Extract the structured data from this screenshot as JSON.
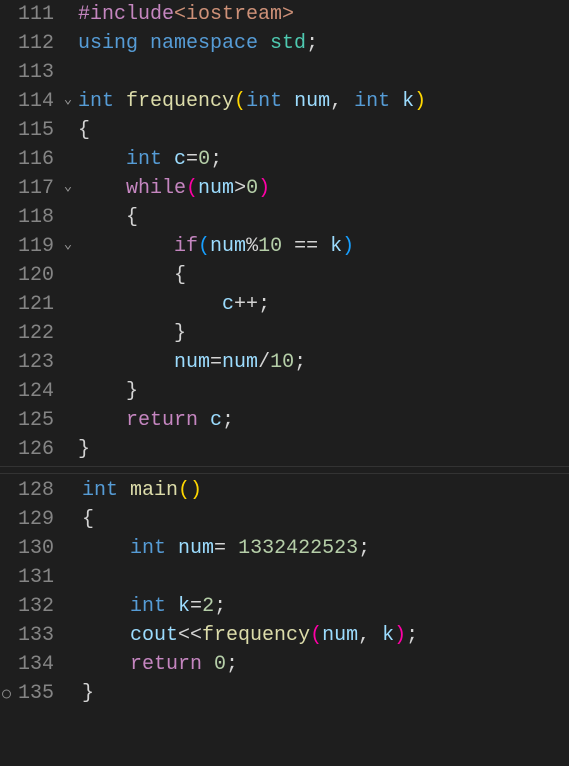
{
  "lines": [
    {
      "n": "111",
      "fold": "",
      "tokens": [
        [
          "pp",
          "#include"
        ],
        [
          "str",
          "<iostream>"
        ]
      ]
    },
    {
      "n": "112",
      "fold": "",
      "tokens": [
        [
          "kw",
          "using "
        ],
        [
          "kw",
          "namespace "
        ],
        [
          "ns",
          "std"
        ],
        [
          "punc",
          ";"
        ]
      ]
    },
    {
      "n": "113",
      "fold": "",
      "tokens": []
    },
    {
      "n": "114",
      "fold": "v",
      "tokens": [
        [
          "kw",
          "int "
        ],
        [
          "fn",
          "frequency"
        ],
        [
          "parenY",
          "("
        ],
        [
          "kw",
          "int "
        ],
        [
          "var",
          "num"
        ],
        [
          "punc",
          ", "
        ],
        [
          "kw",
          "int "
        ],
        [
          "var",
          "k"
        ],
        [
          "parenY",
          ")"
        ]
      ]
    },
    {
      "n": "115",
      "fold": "",
      "tokens": [
        [
          "punc",
          "{"
        ]
      ]
    },
    {
      "n": "116",
      "fold": "",
      "tokens": [
        [
          "punc",
          "    "
        ],
        [
          "kw",
          "int "
        ],
        [
          "var",
          "c"
        ],
        [
          "op",
          "="
        ],
        [
          "num",
          "0"
        ],
        [
          "punc",
          ";"
        ]
      ]
    },
    {
      "n": "117",
      "fold": "v",
      "tokens": [
        [
          "punc",
          "    "
        ],
        [
          "kw2",
          "while"
        ],
        [
          "paren",
          "("
        ],
        [
          "var",
          "num"
        ],
        [
          "op",
          ">"
        ],
        [
          "num",
          "0"
        ],
        [
          "paren",
          ")"
        ]
      ]
    },
    {
      "n": "118",
      "fold": "",
      "tokens": [
        [
          "punc",
          "    {"
        ]
      ]
    },
    {
      "n": "119",
      "fold": "v",
      "tokens": [
        [
          "punc",
          "        "
        ],
        [
          "kw2",
          "if"
        ],
        [
          "paren2",
          "("
        ],
        [
          "var",
          "num"
        ],
        [
          "op",
          "%"
        ],
        [
          "num",
          "10"
        ],
        [
          "op",
          " == "
        ],
        [
          "var",
          "k"
        ],
        [
          "paren2",
          ")"
        ]
      ]
    },
    {
      "n": "120",
      "fold": "",
      "tokens": [
        [
          "punc",
          "        {"
        ]
      ]
    },
    {
      "n": "121",
      "fold": "",
      "tokens": [
        [
          "punc",
          "            "
        ],
        [
          "var",
          "c"
        ],
        [
          "op",
          "++"
        ],
        [
          "punc",
          ";"
        ]
      ]
    },
    {
      "n": "122",
      "fold": "",
      "tokens": [
        [
          "punc",
          "        }"
        ]
      ]
    },
    {
      "n": "123",
      "fold": "",
      "tokens": [
        [
          "punc",
          "        "
        ],
        [
          "var",
          "num"
        ],
        [
          "op",
          "="
        ],
        [
          "var",
          "num"
        ],
        [
          "op",
          "/"
        ],
        [
          "num",
          "10"
        ],
        [
          "punc",
          ";"
        ]
      ]
    },
    {
      "n": "124",
      "fold": "",
      "tokens": [
        [
          "punc",
          "    }"
        ]
      ]
    },
    {
      "n": "125",
      "fold": "",
      "tokens": [
        [
          "punc",
          "    "
        ],
        [
          "kw2",
          "return "
        ],
        [
          "var",
          "c"
        ],
        [
          "punc",
          ";"
        ]
      ]
    },
    {
      "n": "126",
      "fold": "",
      "tokens": [
        [
          "punc",
          "}"
        ]
      ]
    }
  ],
  "lines2": [
    {
      "n": "128",
      "fold": "",
      "tokens": [
        [
          "kw",
          "int "
        ],
        [
          "fn",
          "main"
        ],
        [
          "parenY",
          "()"
        ]
      ]
    },
    {
      "n": "129",
      "fold": "",
      "tokens": [
        [
          "punc",
          "{"
        ]
      ]
    },
    {
      "n": "130",
      "fold": "",
      "tokens": [
        [
          "punc",
          "    "
        ],
        [
          "kw",
          "int "
        ],
        [
          "var",
          "num"
        ],
        [
          "op",
          "= "
        ],
        [
          "num",
          "1332422523"
        ],
        [
          "punc",
          ";"
        ]
      ]
    },
    {
      "n": "131",
      "fold": "",
      "tokens": []
    },
    {
      "n": "132",
      "fold": "",
      "tokens": [
        [
          "punc",
          "    "
        ],
        [
          "kw",
          "int "
        ],
        [
          "var",
          "k"
        ],
        [
          "op",
          "="
        ],
        [
          "num",
          "2"
        ],
        [
          "punc",
          ";"
        ]
      ]
    },
    {
      "n": "133",
      "fold": "",
      "tokens": [
        [
          "punc",
          "    "
        ],
        [
          "var",
          "cout"
        ],
        [
          "op",
          "<<"
        ],
        [
          "fn",
          "frequency"
        ],
        [
          "paren",
          "("
        ],
        [
          "var",
          "num"
        ],
        [
          "punc",
          ", "
        ],
        [
          "var",
          "k"
        ],
        [
          "paren",
          ")"
        ],
        [
          "punc",
          ";"
        ]
      ]
    },
    {
      "n": "134",
      "fold": "",
      "tokens": [
        [
          "punc",
          "    "
        ],
        [
          "kw2",
          "return "
        ],
        [
          "num",
          "0"
        ],
        [
          "punc",
          ";"
        ]
      ]
    },
    {
      "n": "135",
      "fold": "",
      "bp": true,
      "tokens": [
        [
          "punc",
          "}"
        ]
      ]
    }
  ]
}
